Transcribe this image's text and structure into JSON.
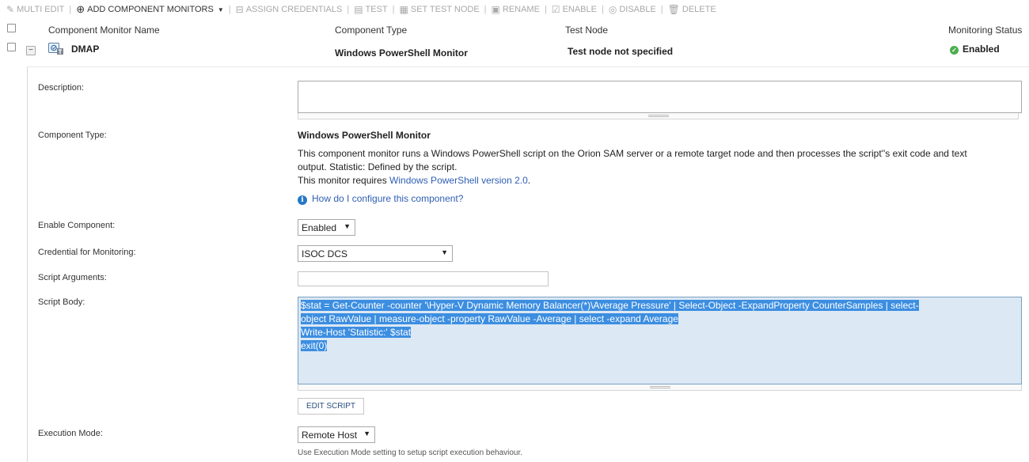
{
  "toolbar": {
    "multi_edit": "MULTI EDIT",
    "add_component_monitors": "ADD COMPONENT MONITORS",
    "assign_credentials": "ASSIGN CREDENTIALS",
    "test": "TEST",
    "set_test_node": "SET TEST NODE",
    "rename": "RENAME",
    "enable": "ENABLE",
    "disable": "DISABLE",
    "delete": "DELETE"
  },
  "table": {
    "columns": [
      "Component Monitor Name",
      "Component Type",
      "Test Node",
      "Monitoring Status"
    ]
  },
  "component": {
    "name": "DMAP",
    "type": "Windows PowerShell Monitor",
    "test_node": "Test node not specified",
    "status": "Enabled",
    "status_color": "#4caf50"
  },
  "details": {
    "description_label": "Description:",
    "description_value": "",
    "component_type_label": "Component Type:",
    "component_type_title": "Windows PowerShell Monitor",
    "component_type_desc_1": "This component monitor runs a Windows PowerShell script on the Orion SAM server or a remote target node and then processes the script''s exit code and text",
    "component_type_desc_2": "output. Statistic: Defined by the script.",
    "requires_prefix": "This monitor requires ",
    "requires_link": "Windows PowerShell version 2.0",
    "requires_suffix": ".",
    "how_to_link": "How do I configure this component?",
    "enable_label": "Enable Component:",
    "enable_value": "Enabled",
    "credential_label": "Credential for Monitoring:",
    "credential_value": "ISOC DCS",
    "script_args_label": "Script Arguments:",
    "script_args_value": "",
    "script_body_label": "Script Body:",
    "script_lines": [
      "$stat = Get-Counter -counter '\\Hyper-V Dynamic Memory Balancer(*)\\Average Pressure' | Select-Object -ExpandProperty CounterSamples | select-",
      "object RawValue | measure-object -property RawValue -Average | select -expand Average",
      "Write-Host 'Statistic:' $stat",
      "exit(0)"
    ],
    "edit_script_label": "EDIT SCRIPT",
    "execution_mode_label": "Execution Mode:",
    "execution_mode_value": "Remote Host",
    "execution_mode_hint": "Use Execution Mode setting to setup script execution behaviour."
  },
  "colors": {
    "link": "#2f5fb3",
    "selection": "#3c8ee1",
    "info": "#2778c4"
  }
}
